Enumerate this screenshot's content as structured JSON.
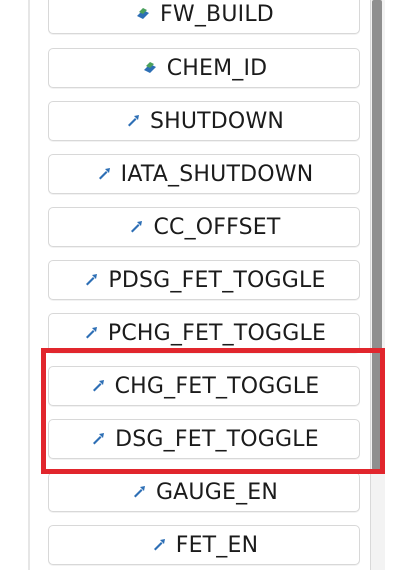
{
  "colors": {
    "highlight": "#e1262d",
    "icon_blue": "#2d6fb5",
    "icon_green": "#4aa05c"
  },
  "buttons": [
    {
      "label": "FW_BUILD",
      "icon": "green-blue-tag-icon"
    },
    {
      "label": "CHEM_ID",
      "icon": "green-blue-tag-icon"
    },
    {
      "label": "SHUTDOWN",
      "icon": "write-arrow-icon"
    },
    {
      "label": "IATA_SHUTDOWN",
      "icon": "write-arrow-icon"
    },
    {
      "label": "CC_OFFSET",
      "icon": "write-arrow-icon"
    },
    {
      "label": "PDSG_FET_TOGGLE",
      "icon": "write-arrow-icon"
    },
    {
      "label": "PCHG_FET_TOGGLE",
      "icon": "write-arrow-icon"
    },
    {
      "label": "CHG_FET_TOGGLE",
      "icon": "write-arrow-icon"
    },
    {
      "label": "DSG_FET_TOGGLE",
      "icon": "write-arrow-icon"
    },
    {
      "label": "GAUGE_EN",
      "icon": "write-arrow-icon"
    },
    {
      "label": "FET_EN",
      "icon": "write-arrow-icon"
    }
  ]
}
